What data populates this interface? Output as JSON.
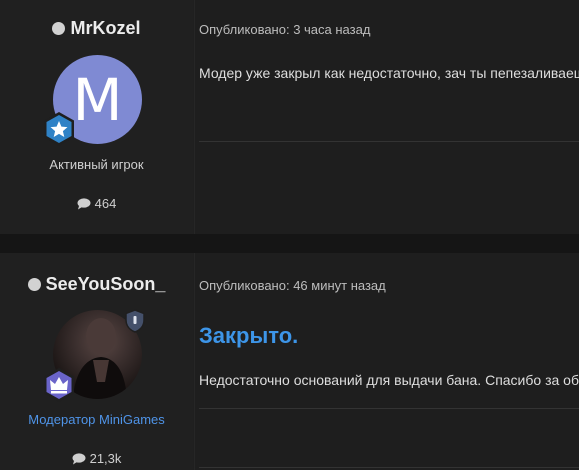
{
  "posts": [
    {
      "username": "MrKozel",
      "avatar_letter": "M",
      "user_title": "Активный игрок",
      "message_count": "464",
      "meta": "Опубликовано: 3 часа назад",
      "body": "Модер уже закрыл как недостаточно, зач ты пепезаливаешь?",
      "colors": {
        "avatar": "#7f8ad3",
        "badge": "#2f82c6"
      }
    },
    {
      "username": "SeeYouSoon_",
      "user_title": "Модератор MiniGames",
      "message_count": "21,3k",
      "meta": "Опубликовано: 46 минут назад",
      "heading": "Закрыто.",
      "body": "Недостаточно оснований для выдачи бана. Спасибо за обращение.",
      "colors": {
        "title": "#4f94e8",
        "heading": "#3d95e8",
        "badge": "#6a64c9"
      }
    }
  ],
  "icons": {
    "status": "status-dot-icon",
    "badge_star": "star-hexagon-badge-icon",
    "badge_crown": "crown-hexagon-badge-icon",
    "shield": "shield-icon",
    "messages": "speech-bubble-icon"
  }
}
